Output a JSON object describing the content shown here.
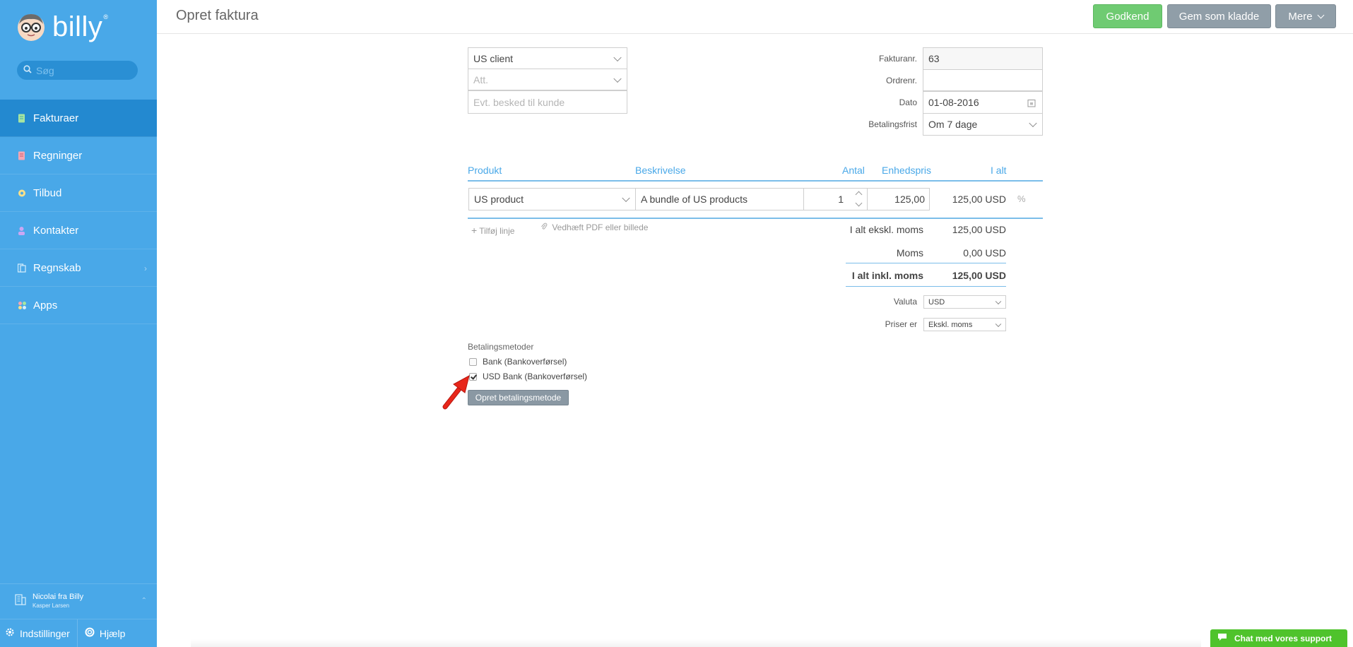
{
  "sidebar": {
    "brand": "billy",
    "brand_mark": "®",
    "search_placeholder": "Søg",
    "items": [
      {
        "label": "Fakturaer",
        "icon": "invoice-icon",
        "active": true
      },
      {
        "label": "Regninger",
        "icon": "bill-icon"
      },
      {
        "label": "Tilbud",
        "icon": "quote-icon"
      },
      {
        "label": "Kontakter",
        "icon": "contacts-icon"
      },
      {
        "label": "Regnskab",
        "icon": "accounting-icon"
      },
      {
        "label": "Apps",
        "icon": "apps-icon"
      }
    ],
    "user": {
      "name": "Nicolai fra Billy",
      "company": "Kasper Larsen"
    },
    "settings_label": "Indstillinger",
    "help_label": "Hjælp"
  },
  "header": {
    "title": "Opret faktura",
    "approve_label": "Godkend",
    "draft_label": "Gem som kladde",
    "more_label": "Mere"
  },
  "invoice": {
    "customer": "US client",
    "att_placeholder": "Att.",
    "message_placeholder": "Evt. besked til kunde",
    "invoice_no_label": "Fakturanr.",
    "invoice_no": "63",
    "order_no_label": "Ordrenr.",
    "order_no": "",
    "date_label": "Dato",
    "date": "01-08-2016",
    "due_label": "Betalingsfrist",
    "due": "Om 7 dage"
  },
  "lines": {
    "headers": {
      "product": "Produkt",
      "description": "Beskrivelse",
      "qty": "Antal",
      "unit_price": "Enhedspris",
      "total": "I alt"
    },
    "rows": [
      {
        "product": "US product",
        "description": "A bundle of US products",
        "qty": "1",
        "unit_price": "125,00",
        "total": "125,00 USD",
        "discount_symbol": "%"
      }
    ],
    "add_line_label": "Tilføj linje",
    "attach_label": "Vedhæft PDF eller billede"
  },
  "totals": {
    "excl_label": "I alt ekskl. moms",
    "excl_value": "125,00 USD",
    "vat_label": "Moms",
    "vat_value": "0,00 USD",
    "incl_label": "I alt inkl. moms",
    "incl_value": "125,00 USD",
    "currency_label": "Valuta",
    "currency": "USD",
    "prices_label": "Priser er",
    "prices": "Ekskl. moms"
  },
  "payment": {
    "section_label": "Betalingsmetoder",
    "methods": [
      {
        "label": "Bank (Bankoverførsel)",
        "checked": false
      },
      {
        "label": "USD Bank (Bankoverførsel)",
        "checked": true
      }
    ],
    "create_label": "Opret betalingsmetode"
  },
  "chat": {
    "label": "Chat med vores support"
  },
  "colors": {
    "sidebar": "#49a8e8",
    "active": "#2389d0",
    "approve": "#6fcb72",
    "gray_button": "#909ea8",
    "chat": "#4fc32c",
    "arrow": "#e8261a"
  }
}
